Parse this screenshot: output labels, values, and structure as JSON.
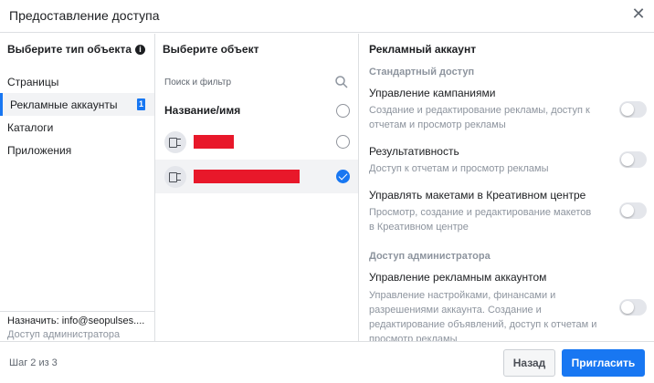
{
  "dialog": {
    "title": "Предоставление доступа"
  },
  "types": {
    "header": "Выберите тип объекта",
    "items": [
      {
        "label": "Страницы"
      },
      {
        "label": "Рекламные аккаунты",
        "badge": "1"
      },
      {
        "label": "Каталоги"
      },
      {
        "label": "Приложения"
      }
    ],
    "assign_line": "Назначить: info@seopulses....",
    "assign_role": "Доступ администратора"
  },
  "objects": {
    "header": "Выберите объект",
    "search_placeholder": "Поиск и фильтр",
    "column_header": "Название/имя"
  },
  "permissions": {
    "title": "Рекламный аккаунт",
    "standard_section": "Стандартный доступ",
    "items": [
      {
        "name": "Управление кампаниями",
        "desc": "Создание и редактирование рекламы, доступ к отчетам и просмотр рекламы"
      },
      {
        "name": "Результативность",
        "desc": "Доступ к отчетам и просмотр рекламы"
      },
      {
        "name": "Управлять макетами в Креативном центре",
        "desc": "Просмотр, создание и редактирование макетов в Креативном центре"
      }
    ],
    "admin_section": "Доступ администратора",
    "admin_item": {
      "name": "Управление рекламным аккаунтом",
      "desc": "Управление настройками, финансами и разрешениями аккаунта. Создание и редактирование объявлений, доступ к отчетам и просмотр рекламы"
    }
  },
  "footer": {
    "step": "Шаг 2 из 3",
    "back_label": "Назад",
    "invite_label": "Пригласить"
  },
  "colors": {
    "accent": "#1877f2",
    "redaction": "#e8182a"
  }
}
